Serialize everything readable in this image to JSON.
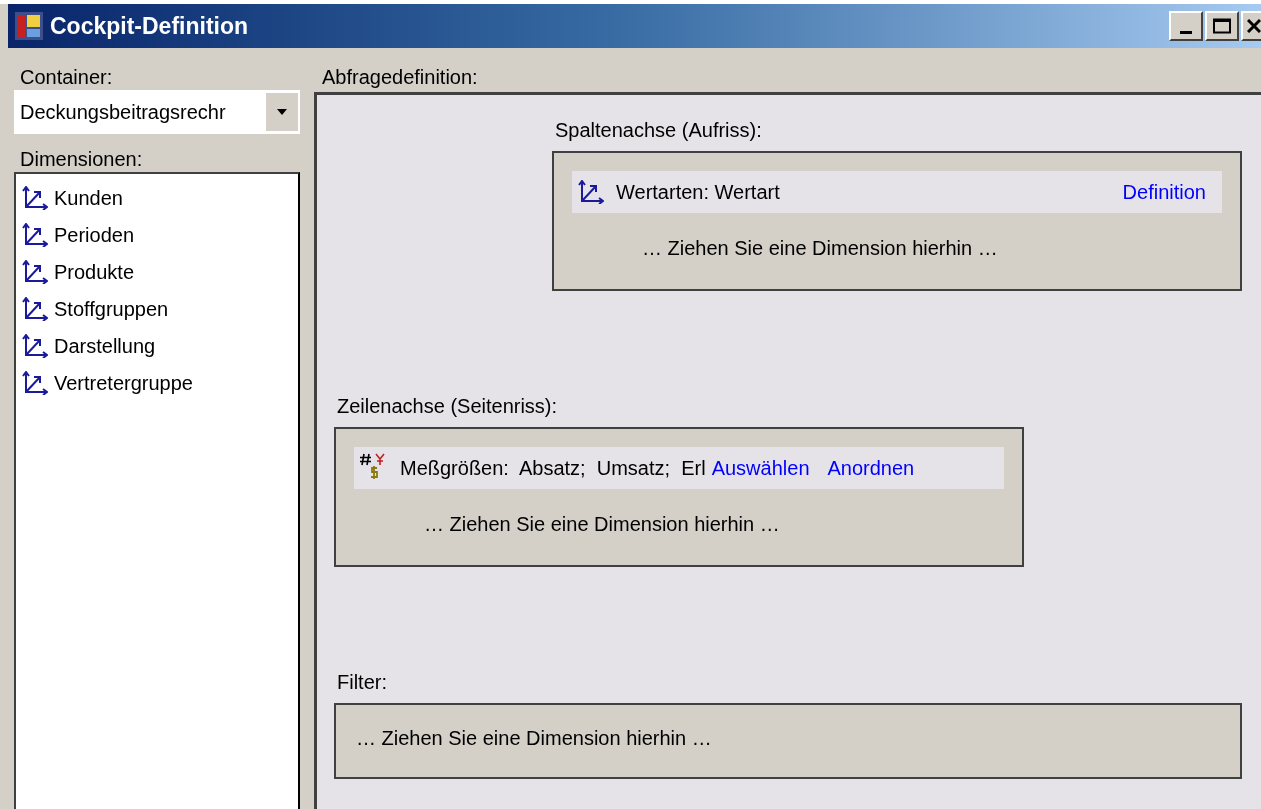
{
  "window": {
    "title": "Cockpit-Definition"
  },
  "container": {
    "label": "Container:",
    "value": "Deckungsbeitragsrechr"
  },
  "dimensions": {
    "label": "Dimensionen:",
    "items": [
      {
        "label": "Kunden"
      },
      {
        "label": "Perioden"
      },
      {
        "label": "Produkte"
      },
      {
        "label": "Stoffgruppen"
      },
      {
        "label": "Darstellung"
      },
      {
        "label": "Vertretergruppe"
      }
    ]
  },
  "query": {
    "label": "Abfragedefinition:",
    "zones": [
      {
        "label": "Spaltenachse (Aufriss):",
        "entries": [
          {
            "kind": "dimension",
            "text": "Wertarten: Wertart",
            "links": [
              "Definition"
            ]
          }
        ],
        "drop_hint": "… Ziehen Sie eine Dimension hierhin …"
      },
      {
        "label": "Zeilenachse (Seitenriss):",
        "entries": [
          {
            "kind": "measures",
            "text": "Meßgrößen:  Absatz;  Umsatz;  Erl",
            "links": [
              "Auswählen",
              "Anordnen"
            ]
          }
        ],
        "drop_hint": "… Ziehen Sie eine Dimension hierhin …"
      },
      {
        "label": "Filter:",
        "drop_hint": "… Ziehen Sie eine Dimension hierhin …"
      }
    ]
  }
}
